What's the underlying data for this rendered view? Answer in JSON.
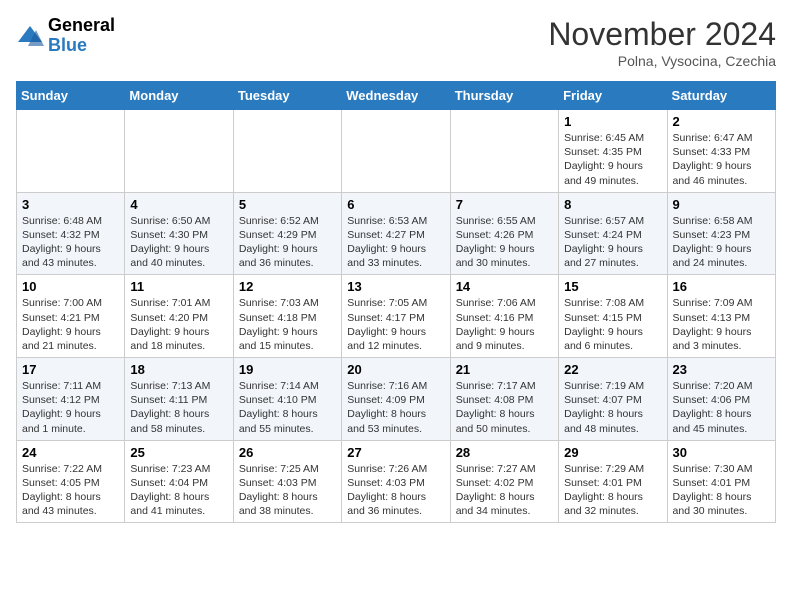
{
  "header": {
    "logo_general": "General",
    "logo_blue": "Blue",
    "month_title": "November 2024",
    "location": "Polna, Vysocina, Czechia"
  },
  "weekdays": [
    "Sunday",
    "Monday",
    "Tuesday",
    "Wednesday",
    "Thursday",
    "Friday",
    "Saturday"
  ],
  "weeks": [
    [
      {
        "day": "",
        "info": ""
      },
      {
        "day": "",
        "info": ""
      },
      {
        "day": "",
        "info": ""
      },
      {
        "day": "",
        "info": ""
      },
      {
        "day": "",
        "info": ""
      },
      {
        "day": "1",
        "info": "Sunrise: 6:45 AM\nSunset: 4:35 PM\nDaylight: 9 hours and 49 minutes."
      },
      {
        "day": "2",
        "info": "Sunrise: 6:47 AM\nSunset: 4:33 PM\nDaylight: 9 hours and 46 minutes."
      }
    ],
    [
      {
        "day": "3",
        "info": "Sunrise: 6:48 AM\nSunset: 4:32 PM\nDaylight: 9 hours and 43 minutes."
      },
      {
        "day": "4",
        "info": "Sunrise: 6:50 AM\nSunset: 4:30 PM\nDaylight: 9 hours and 40 minutes."
      },
      {
        "day": "5",
        "info": "Sunrise: 6:52 AM\nSunset: 4:29 PM\nDaylight: 9 hours and 36 minutes."
      },
      {
        "day": "6",
        "info": "Sunrise: 6:53 AM\nSunset: 4:27 PM\nDaylight: 9 hours and 33 minutes."
      },
      {
        "day": "7",
        "info": "Sunrise: 6:55 AM\nSunset: 4:26 PM\nDaylight: 9 hours and 30 minutes."
      },
      {
        "day": "8",
        "info": "Sunrise: 6:57 AM\nSunset: 4:24 PM\nDaylight: 9 hours and 27 minutes."
      },
      {
        "day": "9",
        "info": "Sunrise: 6:58 AM\nSunset: 4:23 PM\nDaylight: 9 hours and 24 minutes."
      }
    ],
    [
      {
        "day": "10",
        "info": "Sunrise: 7:00 AM\nSunset: 4:21 PM\nDaylight: 9 hours and 21 minutes."
      },
      {
        "day": "11",
        "info": "Sunrise: 7:01 AM\nSunset: 4:20 PM\nDaylight: 9 hours and 18 minutes."
      },
      {
        "day": "12",
        "info": "Sunrise: 7:03 AM\nSunset: 4:18 PM\nDaylight: 9 hours and 15 minutes."
      },
      {
        "day": "13",
        "info": "Sunrise: 7:05 AM\nSunset: 4:17 PM\nDaylight: 9 hours and 12 minutes."
      },
      {
        "day": "14",
        "info": "Sunrise: 7:06 AM\nSunset: 4:16 PM\nDaylight: 9 hours and 9 minutes."
      },
      {
        "day": "15",
        "info": "Sunrise: 7:08 AM\nSunset: 4:15 PM\nDaylight: 9 hours and 6 minutes."
      },
      {
        "day": "16",
        "info": "Sunrise: 7:09 AM\nSunset: 4:13 PM\nDaylight: 9 hours and 3 minutes."
      }
    ],
    [
      {
        "day": "17",
        "info": "Sunrise: 7:11 AM\nSunset: 4:12 PM\nDaylight: 9 hours and 1 minute."
      },
      {
        "day": "18",
        "info": "Sunrise: 7:13 AM\nSunset: 4:11 PM\nDaylight: 8 hours and 58 minutes."
      },
      {
        "day": "19",
        "info": "Sunrise: 7:14 AM\nSunset: 4:10 PM\nDaylight: 8 hours and 55 minutes."
      },
      {
        "day": "20",
        "info": "Sunrise: 7:16 AM\nSunset: 4:09 PM\nDaylight: 8 hours and 53 minutes."
      },
      {
        "day": "21",
        "info": "Sunrise: 7:17 AM\nSunset: 4:08 PM\nDaylight: 8 hours and 50 minutes."
      },
      {
        "day": "22",
        "info": "Sunrise: 7:19 AM\nSunset: 4:07 PM\nDaylight: 8 hours and 48 minutes."
      },
      {
        "day": "23",
        "info": "Sunrise: 7:20 AM\nSunset: 4:06 PM\nDaylight: 8 hours and 45 minutes."
      }
    ],
    [
      {
        "day": "24",
        "info": "Sunrise: 7:22 AM\nSunset: 4:05 PM\nDaylight: 8 hours and 43 minutes."
      },
      {
        "day": "25",
        "info": "Sunrise: 7:23 AM\nSunset: 4:04 PM\nDaylight: 8 hours and 41 minutes."
      },
      {
        "day": "26",
        "info": "Sunrise: 7:25 AM\nSunset: 4:03 PM\nDaylight: 8 hours and 38 minutes."
      },
      {
        "day": "27",
        "info": "Sunrise: 7:26 AM\nSunset: 4:03 PM\nDaylight: 8 hours and 36 minutes."
      },
      {
        "day": "28",
        "info": "Sunrise: 7:27 AM\nSunset: 4:02 PM\nDaylight: 8 hours and 34 minutes."
      },
      {
        "day": "29",
        "info": "Sunrise: 7:29 AM\nSunset: 4:01 PM\nDaylight: 8 hours and 32 minutes."
      },
      {
        "day": "30",
        "info": "Sunrise: 7:30 AM\nSunset: 4:01 PM\nDaylight: 8 hours and 30 minutes."
      }
    ]
  ]
}
